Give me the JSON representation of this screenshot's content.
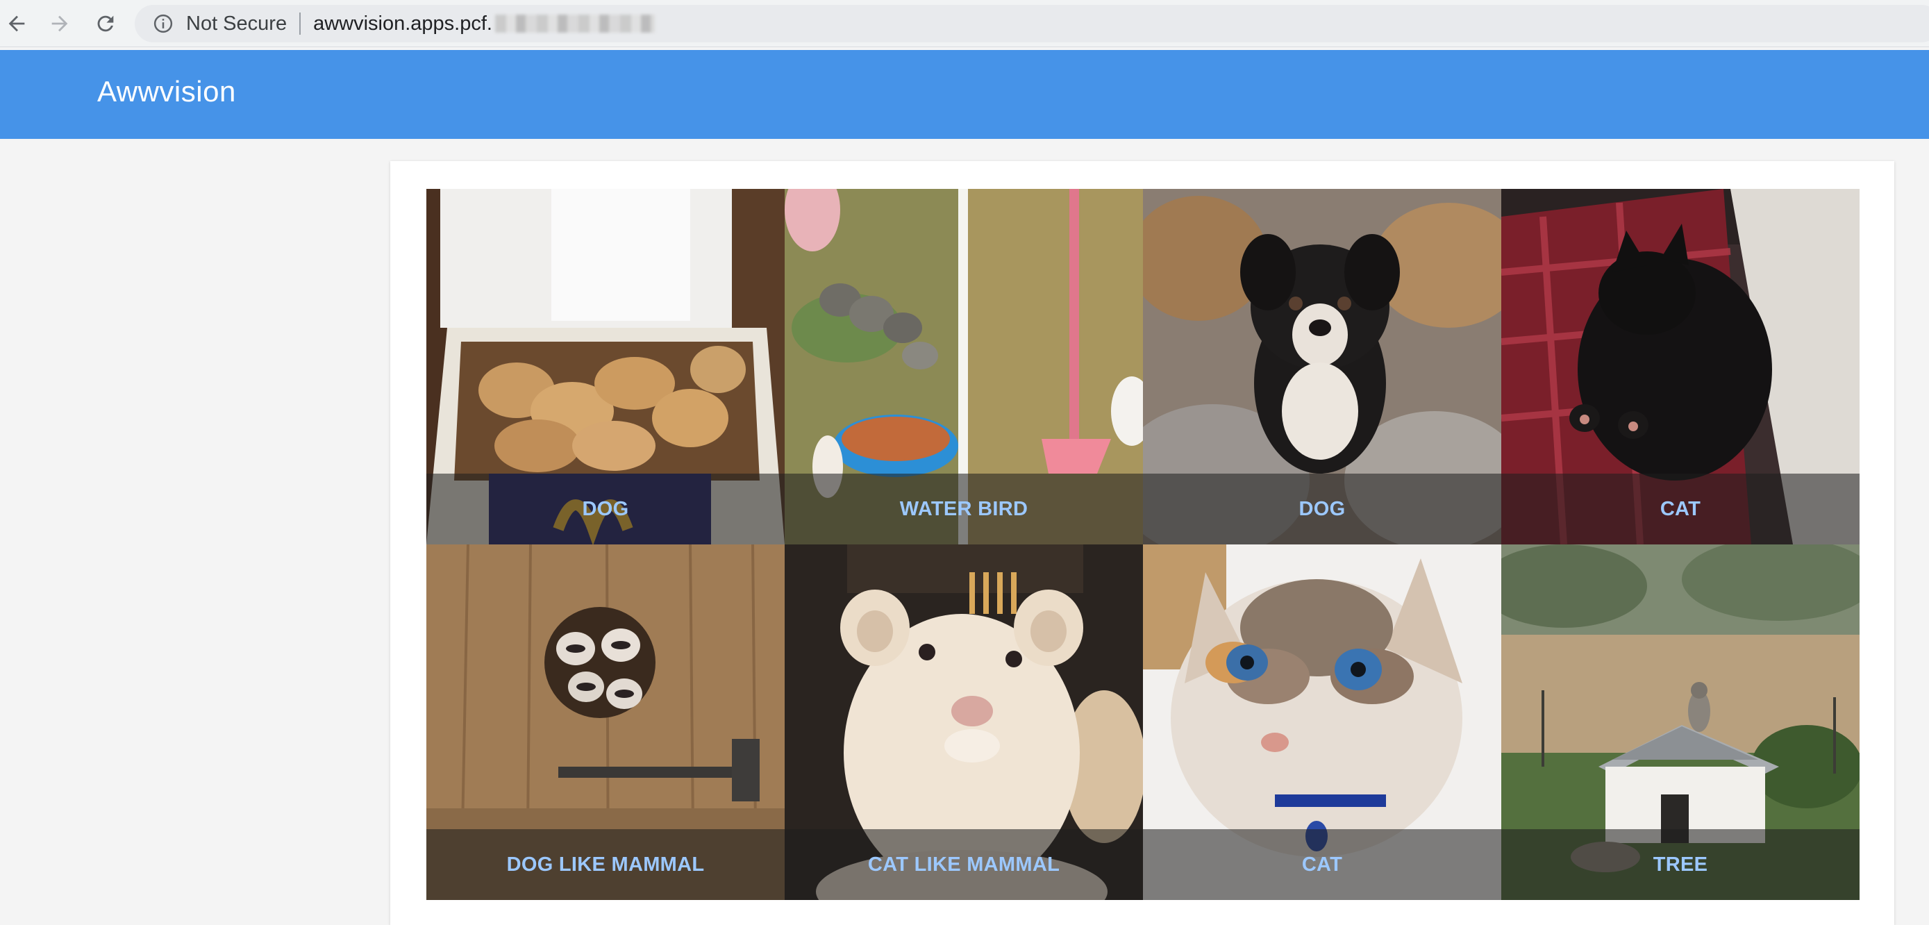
{
  "browser": {
    "security_label": "Not Secure",
    "url": "awwvision.apps.pcf."
  },
  "app": {
    "title": "Awwvision"
  },
  "colors": {
    "header": "#4693e8",
    "caption_text": "#9cc8ff"
  },
  "gallery": {
    "tiles": [
      {
        "label": "DOG"
      },
      {
        "label": "WATER BIRD"
      },
      {
        "label": "DOG"
      },
      {
        "label": "CAT"
      },
      {
        "label": "DOG LIKE MAMMAL"
      },
      {
        "label": "CAT LIKE MAMMAL"
      },
      {
        "label": "CAT"
      },
      {
        "label": "TREE"
      }
    ]
  }
}
